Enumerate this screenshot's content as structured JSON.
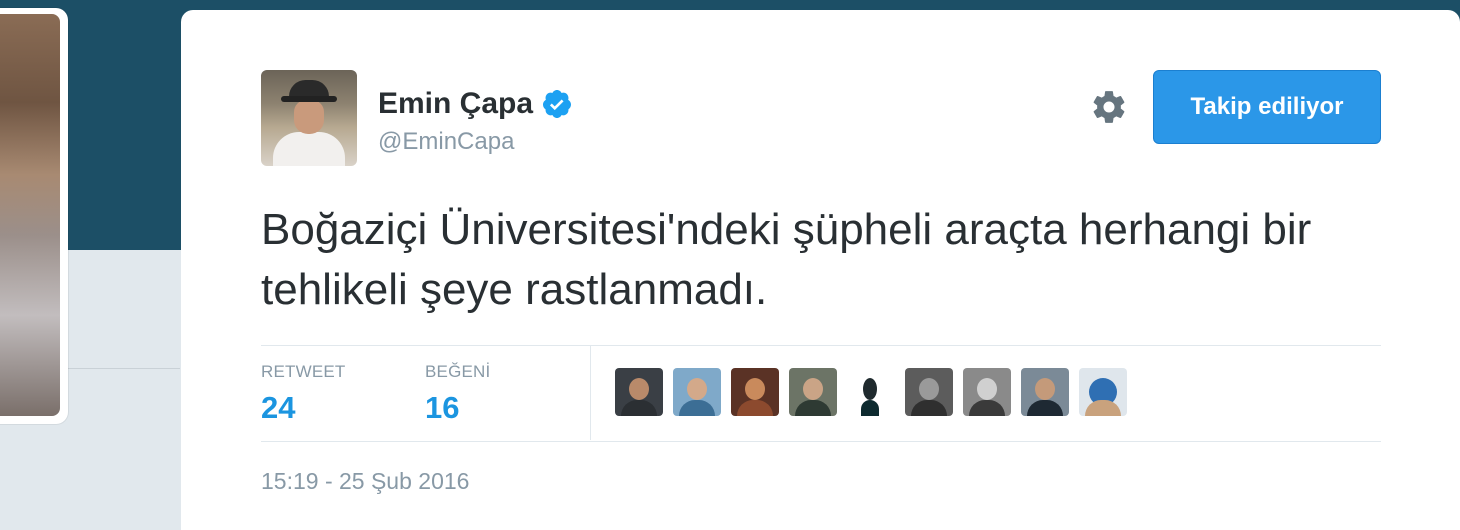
{
  "tweet": {
    "author": {
      "name": "Emin Çapa",
      "handle": "@EminCapa",
      "verified": true
    },
    "follow_button_label": "Takip ediliyor",
    "text": "Boğaziçi Üniversitesi'ndeki şüpheli araçta herhangi bir tehlikeli şeye rastlanmadı.",
    "stats": {
      "retweet_label": "RETWEET",
      "retweet_count": "24",
      "like_label": "BEĞENİ",
      "like_count": "16"
    },
    "timestamp": "15:19 - 25 Şub 2016"
  },
  "colors": {
    "accent": "#1b95e0",
    "button": "#2b97e8",
    "header_band": "#1c4f66",
    "muted_text": "#8899a6",
    "body_text": "#292f33"
  },
  "icons": {
    "verified": "verified-badge-icon",
    "settings": "gear-icon"
  }
}
